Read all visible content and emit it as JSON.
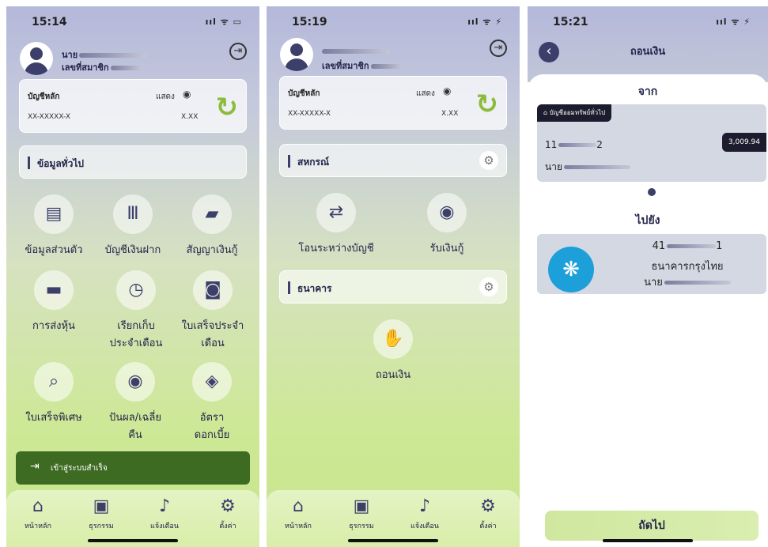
{
  "screen1": {
    "time": "15:14",
    "signal": "ııl ᯤ ▭",
    "prefix1": "นาย",
    "prefix2": "เลขที่สมาชิก",
    "account": {
      "title": "บัญชีหลัก",
      "show": "แสดง",
      "number": "XX-XXXXX-X",
      "balance": "X.XX"
    },
    "section": "ข้อมูลทั่วไป",
    "menu": [
      {
        "label": "ข้อมูลส่วนตัว",
        "icon": "id-card-icon",
        "glyph": "▤"
      },
      {
        "label": "บัญชีเงินฝาก",
        "icon": "bank-pillars-icon",
        "glyph": "Ⅲ"
      },
      {
        "label": "สัญญาเงินกู้",
        "icon": "folder-icon",
        "glyph": "▰"
      },
      {
        "label": "การส่งหุ้น",
        "icon": "cash-icon",
        "glyph": "▬"
      },
      {
        "label": "เรียกเก็บประจำเดือน",
        "icon": "calendar-clock-icon",
        "glyph": "◷"
      },
      {
        "label": "ใบเสร็จประจำเดือน",
        "icon": "receipt-coin-icon",
        "glyph": "◙"
      },
      {
        "label": "ใบเสร็จพิเศษ",
        "icon": "bank-search-icon",
        "glyph": "⌕"
      },
      {
        "label": "ปันผล/เฉลี่ยคืน",
        "icon": "coin-icon",
        "glyph": "◉"
      },
      {
        "label": "อัตราดอกเบี้ย",
        "icon": "rate-icon",
        "glyph": "◈"
      }
    ],
    "toast": "เข้าสู่ระบบสำเร็จ"
  },
  "screen2": {
    "time": "15:19",
    "signal": "ııl ᯤ ⚡",
    "prefix2": "เลขที่สมาชิก",
    "account": {
      "title": "บัญชีหลัก",
      "show": "แสดง",
      "number": "XX-XXXXX-X",
      "balance": "X.XX"
    },
    "section1": "สหกรณ์",
    "section2": "ธนาคาร",
    "menu1": [
      {
        "label": "โอนระหว่างบัญชี",
        "icon": "transfer-icon",
        "glyph": "⇄"
      },
      {
        "label": "รับเงินกู้",
        "icon": "receive-loan-icon",
        "glyph": "◉"
      }
    ],
    "menu2": [
      {
        "label": "ถอนเงิน",
        "icon": "withdraw-icon",
        "glyph": "✋"
      }
    ]
  },
  "nav": [
    {
      "label": "หน้าหลัก",
      "icon": "home-icon",
      "glyph": "⌂"
    },
    {
      "label": "ธุรกรรม",
      "icon": "money-icon",
      "glyph": "▣"
    },
    {
      "label": "แจ้งเตือน",
      "icon": "bell-icon",
      "glyph": "♪"
    },
    {
      "label": "ตั้งค่า",
      "icon": "gear-icon",
      "glyph": "⚙"
    }
  ],
  "screen3": {
    "time": "15:21",
    "signal": "ııl ᯤ ⚡",
    "title": "ถอนเงิน",
    "from": "จาก",
    "from_card": {
      "tag": "บัญชีออมทรัพย์ทั่วไป",
      "num_prefix": "11",
      "num_suffix": "2",
      "owner": "นาย",
      "balance": "3,009.94"
    },
    "to": "ไปยัง",
    "to_card": {
      "num_prefix": "41",
      "num_suffix": "1",
      "bank": "ธนาคารกรุงไทย",
      "owner": "นาย"
    },
    "next": "ถัดไป"
  }
}
